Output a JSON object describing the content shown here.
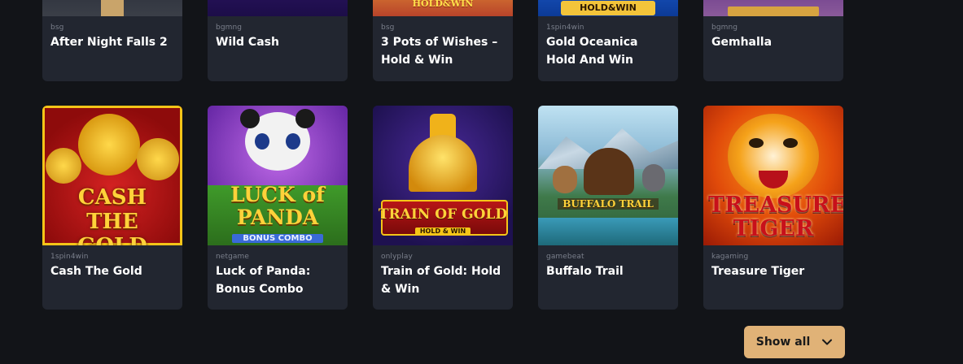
{
  "games_top": [
    {
      "provider": "bsg",
      "title": "After Night Falls 2"
    },
    {
      "provider": "bgmng",
      "title": "Wild Cash"
    },
    {
      "provider": "bsg",
      "title": "3 Pots of Wishes – Hold & Win",
      "banner": "HOLD&WIN"
    },
    {
      "provider": "1spin4win",
      "title": "Gold Oceanica Hold And Win",
      "banner": "HOLD&WIN"
    },
    {
      "provider": "bgmng",
      "title": "Gemhalla"
    }
  ],
  "games_bottom": [
    {
      "provider": "1spin4win",
      "title": "Cash The Gold",
      "art_text": "CASH THE GOLD"
    },
    {
      "provider": "netgame",
      "title": "Luck of Panda: Bonus Combo",
      "art_text": "LUCK of PANDA",
      "art_sub": "BONUS COMBO"
    },
    {
      "provider": "onlyplay",
      "title": "Train of Gold: Hold & Win",
      "art_text": "TRAIN OF GOLD",
      "art_sub": "HOLD & WIN"
    },
    {
      "provider": "gamebeat",
      "title": "Buffalo Trail",
      "art_text": "BUFFALO TRAIL"
    },
    {
      "provider": "kagaming",
      "title": "Treasure Tiger",
      "art_text": "TREASURE TIGER"
    }
  ],
  "show_all_label": "Show all",
  "colors": {
    "background": "#121418",
    "card": "#222630",
    "accent": "#e0b277",
    "provider_text": "#7a7f8b"
  },
  "icons": {
    "show_all": "chevron-down-icon"
  }
}
